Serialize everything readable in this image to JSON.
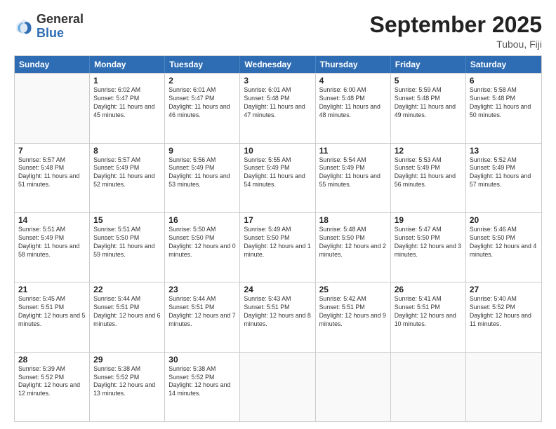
{
  "header": {
    "logo_general": "General",
    "logo_blue": "Blue",
    "month_year": "September 2025",
    "location": "Tubou, Fiji"
  },
  "days_of_week": [
    "Sunday",
    "Monday",
    "Tuesday",
    "Wednesday",
    "Thursday",
    "Friday",
    "Saturday"
  ],
  "weeks": [
    [
      {
        "day": "",
        "empty": true
      },
      {
        "day": "1",
        "sunrise": "Sunrise: 6:02 AM",
        "sunset": "Sunset: 5:47 PM",
        "daylight": "Daylight: 11 hours and 45 minutes."
      },
      {
        "day": "2",
        "sunrise": "Sunrise: 6:01 AM",
        "sunset": "Sunset: 5:47 PM",
        "daylight": "Daylight: 11 hours and 46 minutes."
      },
      {
        "day": "3",
        "sunrise": "Sunrise: 6:01 AM",
        "sunset": "Sunset: 5:48 PM",
        "daylight": "Daylight: 11 hours and 47 minutes."
      },
      {
        "day": "4",
        "sunrise": "Sunrise: 6:00 AM",
        "sunset": "Sunset: 5:48 PM",
        "daylight": "Daylight: 11 hours and 48 minutes."
      },
      {
        "day": "5",
        "sunrise": "Sunrise: 5:59 AM",
        "sunset": "Sunset: 5:48 PM",
        "daylight": "Daylight: 11 hours and 49 minutes."
      },
      {
        "day": "6",
        "sunrise": "Sunrise: 5:58 AM",
        "sunset": "Sunset: 5:48 PM",
        "daylight": "Daylight: 11 hours and 50 minutes."
      }
    ],
    [
      {
        "day": "7",
        "sunrise": "Sunrise: 5:57 AM",
        "sunset": "Sunset: 5:48 PM",
        "daylight": "Daylight: 11 hours and 51 minutes."
      },
      {
        "day": "8",
        "sunrise": "Sunrise: 5:57 AM",
        "sunset": "Sunset: 5:49 PM",
        "daylight": "Daylight: 11 hours and 52 minutes."
      },
      {
        "day": "9",
        "sunrise": "Sunrise: 5:56 AM",
        "sunset": "Sunset: 5:49 PM",
        "daylight": "Daylight: 11 hours and 53 minutes."
      },
      {
        "day": "10",
        "sunrise": "Sunrise: 5:55 AM",
        "sunset": "Sunset: 5:49 PM",
        "daylight": "Daylight: 11 hours and 54 minutes."
      },
      {
        "day": "11",
        "sunrise": "Sunrise: 5:54 AM",
        "sunset": "Sunset: 5:49 PM",
        "daylight": "Daylight: 11 hours and 55 minutes."
      },
      {
        "day": "12",
        "sunrise": "Sunrise: 5:53 AM",
        "sunset": "Sunset: 5:49 PM",
        "daylight": "Daylight: 11 hours and 56 minutes."
      },
      {
        "day": "13",
        "sunrise": "Sunrise: 5:52 AM",
        "sunset": "Sunset: 5:49 PM",
        "daylight": "Daylight: 11 hours and 57 minutes."
      }
    ],
    [
      {
        "day": "14",
        "sunrise": "Sunrise: 5:51 AM",
        "sunset": "Sunset: 5:49 PM",
        "daylight": "Daylight: 11 hours and 58 minutes."
      },
      {
        "day": "15",
        "sunrise": "Sunrise: 5:51 AM",
        "sunset": "Sunset: 5:50 PM",
        "daylight": "Daylight: 11 hours and 59 minutes."
      },
      {
        "day": "16",
        "sunrise": "Sunrise: 5:50 AM",
        "sunset": "Sunset: 5:50 PM",
        "daylight": "Daylight: 12 hours and 0 minutes."
      },
      {
        "day": "17",
        "sunrise": "Sunrise: 5:49 AM",
        "sunset": "Sunset: 5:50 PM",
        "daylight": "Daylight: 12 hours and 1 minute."
      },
      {
        "day": "18",
        "sunrise": "Sunrise: 5:48 AM",
        "sunset": "Sunset: 5:50 PM",
        "daylight": "Daylight: 12 hours and 2 minutes."
      },
      {
        "day": "19",
        "sunrise": "Sunrise: 5:47 AM",
        "sunset": "Sunset: 5:50 PM",
        "daylight": "Daylight: 12 hours and 3 minutes."
      },
      {
        "day": "20",
        "sunrise": "Sunrise: 5:46 AM",
        "sunset": "Sunset: 5:50 PM",
        "daylight": "Daylight: 12 hours and 4 minutes."
      }
    ],
    [
      {
        "day": "21",
        "sunrise": "Sunrise: 5:45 AM",
        "sunset": "Sunset: 5:51 PM",
        "daylight": "Daylight: 12 hours and 5 minutes."
      },
      {
        "day": "22",
        "sunrise": "Sunrise: 5:44 AM",
        "sunset": "Sunset: 5:51 PM",
        "daylight": "Daylight: 12 hours and 6 minutes."
      },
      {
        "day": "23",
        "sunrise": "Sunrise: 5:44 AM",
        "sunset": "Sunset: 5:51 PM",
        "daylight": "Daylight: 12 hours and 7 minutes."
      },
      {
        "day": "24",
        "sunrise": "Sunrise: 5:43 AM",
        "sunset": "Sunset: 5:51 PM",
        "daylight": "Daylight: 12 hours and 8 minutes."
      },
      {
        "day": "25",
        "sunrise": "Sunrise: 5:42 AM",
        "sunset": "Sunset: 5:51 PM",
        "daylight": "Daylight: 12 hours and 9 minutes."
      },
      {
        "day": "26",
        "sunrise": "Sunrise: 5:41 AM",
        "sunset": "Sunset: 5:51 PM",
        "daylight": "Daylight: 12 hours and 10 minutes."
      },
      {
        "day": "27",
        "sunrise": "Sunrise: 5:40 AM",
        "sunset": "Sunset: 5:52 PM",
        "daylight": "Daylight: 12 hours and 11 minutes."
      }
    ],
    [
      {
        "day": "28",
        "sunrise": "Sunrise: 5:39 AM",
        "sunset": "Sunset: 5:52 PM",
        "daylight": "Daylight: 12 hours and 12 minutes."
      },
      {
        "day": "29",
        "sunrise": "Sunrise: 5:38 AM",
        "sunset": "Sunset: 5:52 PM",
        "daylight": "Daylight: 12 hours and 13 minutes."
      },
      {
        "day": "30",
        "sunrise": "Sunrise: 5:38 AM",
        "sunset": "Sunset: 5:52 PM",
        "daylight": "Daylight: 12 hours and 14 minutes."
      },
      {
        "day": "",
        "empty": true
      },
      {
        "day": "",
        "empty": true
      },
      {
        "day": "",
        "empty": true
      },
      {
        "day": "",
        "empty": true
      }
    ]
  ]
}
